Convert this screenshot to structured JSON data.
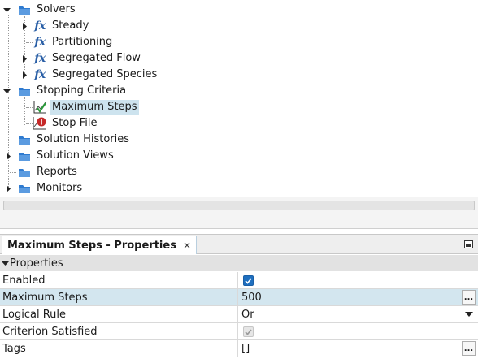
{
  "tree": {
    "items": [
      {
        "label": "Solvers",
        "icon": "folder-icon"
      },
      {
        "label": "Steady",
        "icon": "function-icon",
        "glyph": "fx"
      },
      {
        "label": "Partitioning",
        "icon": "function-icon",
        "glyph": "fx"
      },
      {
        "label": "Segregated Flow",
        "icon": "function-icon",
        "glyph": "fx"
      },
      {
        "label": "Segregated Species",
        "icon": "function-icon",
        "glyph": "fx"
      },
      {
        "label": "Stopping Criteria",
        "icon": "folder-icon"
      },
      {
        "label": "Maximum Steps",
        "icon": "chart-check-icon",
        "selected": true
      },
      {
        "label": "Stop File",
        "icon": "chart-alert-icon"
      },
      {
        "label": "Solution Histories",
        "icon": "folder-icon"
      },
      {
        "label": "Solution Views",
        "icon": "folder-icon"
      },
      {
        "label": "Reports",
        "icon": "folder-icon"
      },
      {
        "label": "Monitors",
        "icon": "folder-icon"
      }
    ]
  },
  "properties_panel": {
    "tab_title": "Maximum Steps - Properties",
    "close_glyph": "×",
    "section_title": "Properties",
    "rows": [
      {
        "name": "Enabled",
        "type": "checkbox",
        "checked": true
      },
      {
        "name": "Maximum Steps",
        "type": "text",
        "value": "500",
        "ellipsis": "..."
      },
      {
        "name": "Logical Rule",
        "type": "dropdown",
        "value": "Or"
      },
      {
        "name": "Criterion Satisfied",
        "type": "checkbox",
        "checked": true,
        "disabled": true
      },
      {
        "name": "Tags",
        "type": "text",
        "value": "[]",
        "ellipsis": "..."
      }
    ]
  },
  "colors": {
    "folder": "#2f7bd0",
    "selection": "#cde3ee",
    "row_highlight": "#d3e6ef",
    "checkbox_on": "#1f6fbf"
  }
}
